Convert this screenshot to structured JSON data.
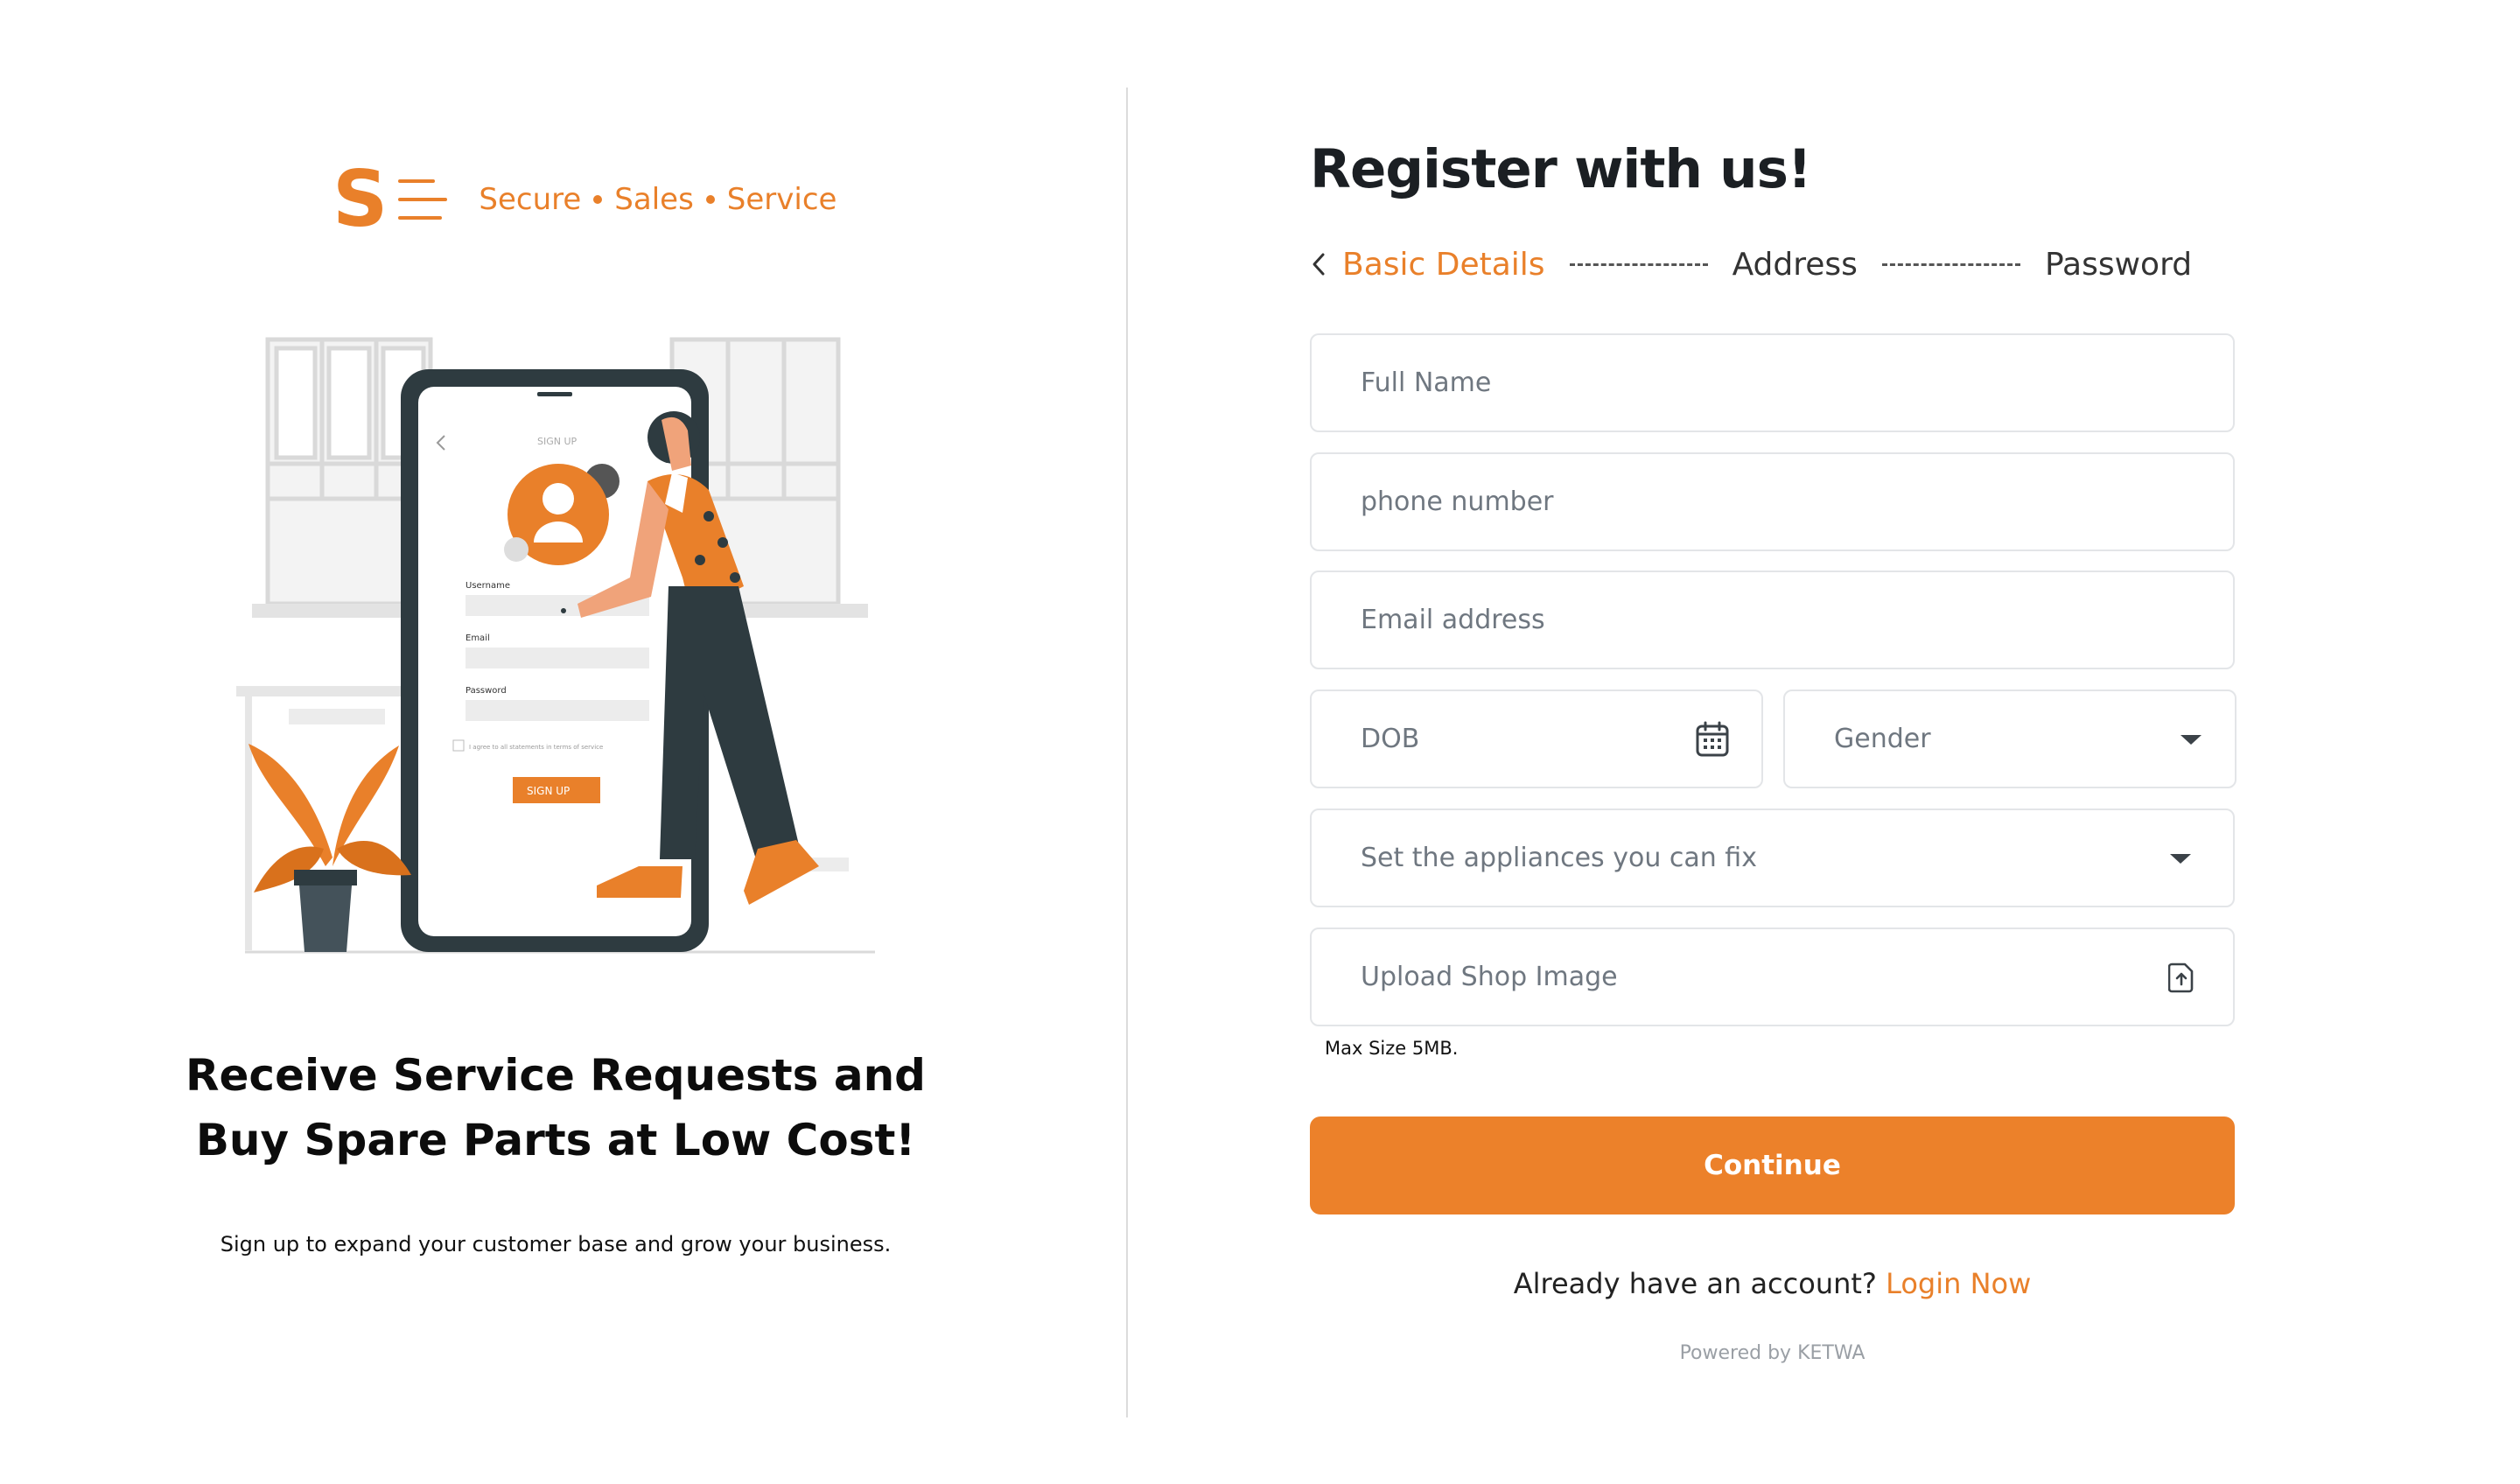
{
  "brand": {
    "logo_letter": "S",
    "tagline": [
      "Secure",
      "Sales",
      "Service"
    ],
    "accent_color": "#e9802a"
  },
  "hero": {
    "title_line1": "Receive Service Requests and",
    "title_line2": "Buy Spare Parts at Low Cost!",
    "subtitle": "Sign up to expand your customer base and grow your business."
  },
  "illustration": {
    "screen_title": "SIGN UP",
    "username_label": "Username",
    "email_label": "Email",
    "password_label": "Password",
    "agree_text": "I agree to all statements in terms of service",
    "signup_button": "SIGN UP"
  },
  "register": {
    "title": "Register with us!",
    "steps": [
      "Basic Details",
      "Address",
      "Password"
    ],
    "active_step": 0
  },
  "form": {
    "full_name_placeholder": "Full Name",
    "phone_placeholder": "phone number",
    "email_placeholder": "Email address",
    "dob_placeholder": "DOB",
    "gender_placeholder": "Gender",
    "appliances_placeholder": "Set the appliances you can fix",
    "upload_placeholder": "Upload Shop Image",
    "max_size_note": "Max Size 5MB."
  },
  "actions": {
    "continue_label": "Continue",
    "have_account_text": "Already have an account?",
    "login_label": "Login Now"
  },
  "footer": {
    "powered_by": "Powered by KETWA"
  },
  "icons": {
    "back": "chevron-left-icon",
    "calendar": "calendar-icon",
    "dropdown": "caret-down-icon",
    "upload": "file-upload-icon"
  }
}
